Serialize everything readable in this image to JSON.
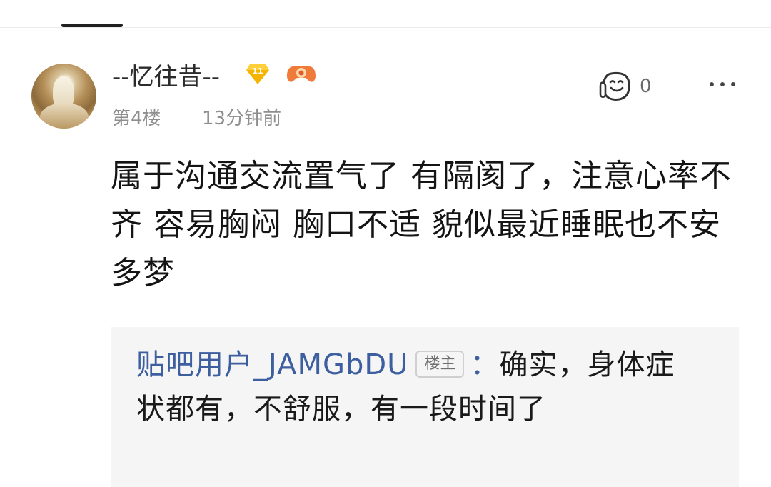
{
  "post": {
    "username": "--忆往昔--",
    "level": "11",
    "floor": "第4楼",
    "time": "13分钟前",
    "like_count": "0",
    "content": "属于沟通交流置气了 有隔阂了，注意心率不齐 容易胸闷 胸口不适 貌似最近睡眠也不安 多梦"
  },
  "reply": {
    "user": "贴吧用户_JAMGbDU",
    "badge": "楼主",
    "separator": "：",
    "text": "确实，身体症状都有，不舒服，有一段时间了"
  },
  "icons": {
    "level_badge": "diamond-level-badge-icon",
    "game": "game-controller-icon",
    "like": "like-face-icon",
    "more": "more-dots-icon"
  },
  "colors": {
    "reply_user": "#3d5fa0",
    "badge_gold": "#f5b400",
    "controller_orange": "#f07a3a"
  }
}
